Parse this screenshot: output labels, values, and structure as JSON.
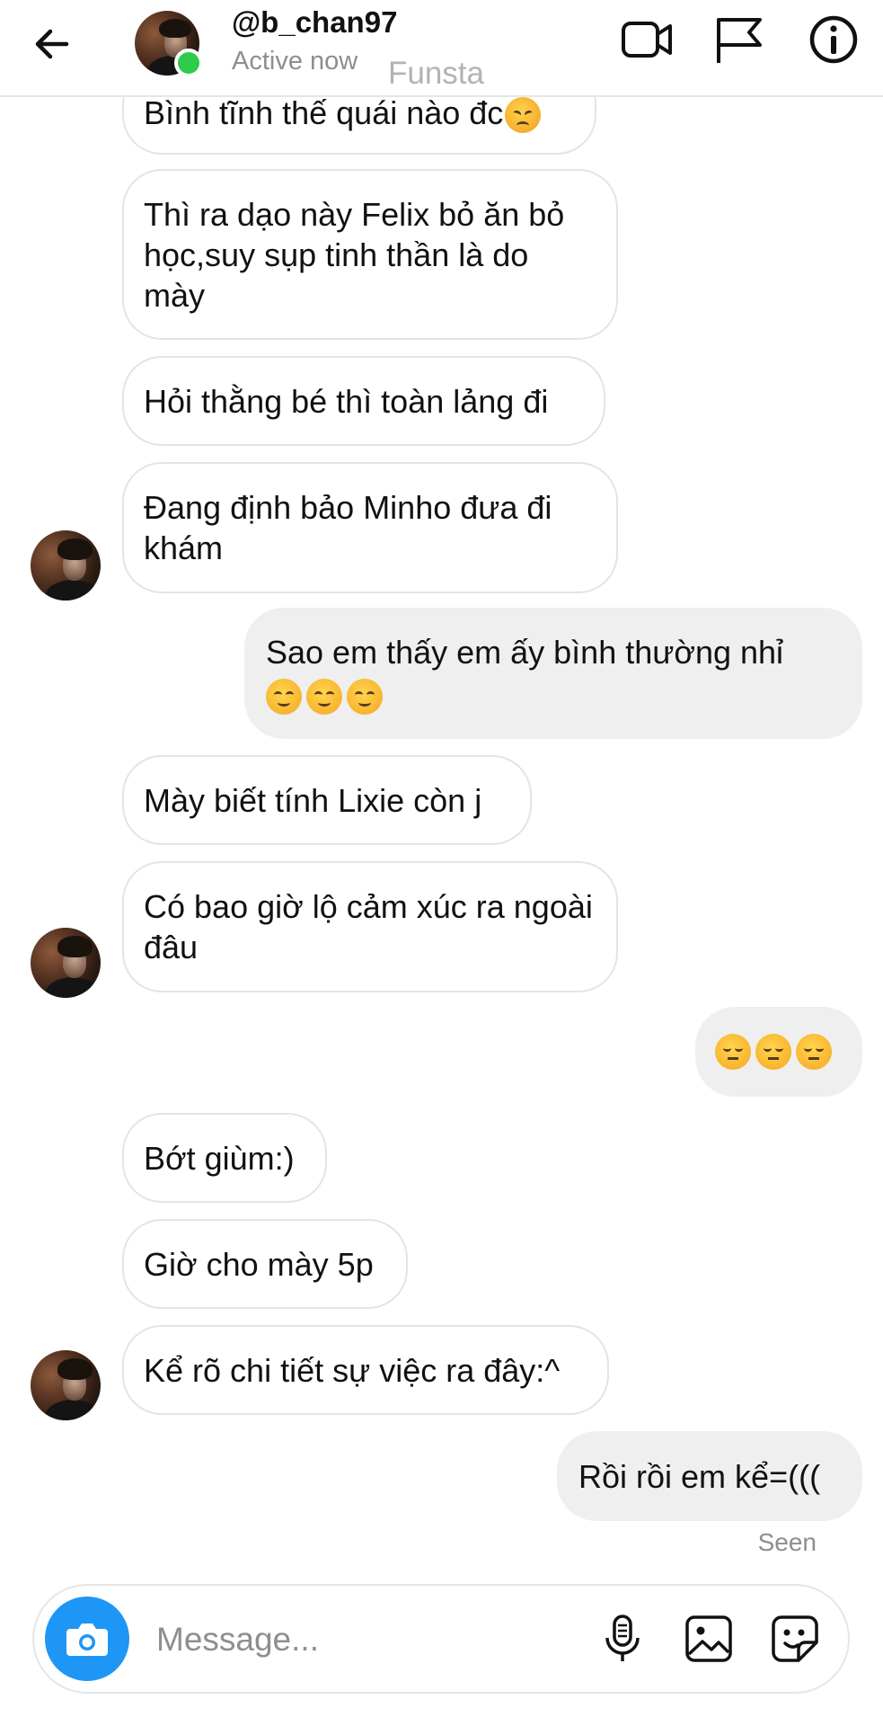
{
  "header": {
    "username": "@b_chan97",
    "status": "Active now",
    "watermark": "Funsta",
    "icons": [
      "back-arrow-icon",
      "video-camera-icon",
      "flag-icon",
      "info-icon"
    ]
  },
  "messages": [
    {
      "dir": "received",
      "text": "Bình tĩnh thế quái nào đc",
      "emoji": [
        "angry"
      ]
    },
    {
      "dir": "received",
      "text": "Thì ra dạo này Felix bỏ ăn bỏ học,suy sụp tinh thần là do mày"
    },
    {
      "dir": "received",
      "text": "Hỏi thằng bé thì toàn lảng đi"
    },
    {
      "dir": "received",
      "text": "Đang định bảo Minho đưa đi khám"
    },
    {
      "dir": "sent",
      "text": "Sao em thấy em ấy bình thường nhỉ",
      "emoji": [
        "upside",
        "upside",
        "upside"
      ]
    },
    {
      "dir": "received",
      "text": "Mày biết tính Lixie còn j"
    },
    {
      "dir": "received",
      "text": "Có bao giờ lộ cảm xúc ra ngoài đâu"
    },
    {
      "dir": "sent",
      "text": "",
      "emoji": [
        "pensive",
        "pensive",
        "pensive"
      ]
    },
    {
      "dir": "received",
      "text": "Bớt giùm:)"
    },
    {
      "dir": "received",
      "text": "Giờ cho mày 5p"
    },
    {
      "dir": "received",
      "text": "Kể rõ chi tiết sự việc ra đây:^"
    },
    {
      "dir": "sent",
      "text": "Rồi rồi em kể=((("
    }
  ],
  "seen_label": "Seen",
  "composer": {
    "placeholder": "Message...",
    "icons": [
      "camera-icon",
      "microphone-icon",
      "gallery-icon",
      "sticker-icon"
    ]
  },
  "colors": {
    "camera_button": "#1e96f5",
    "sent_bubble": "#efefef",
    "online": "#2ecc4a"
  }
}
